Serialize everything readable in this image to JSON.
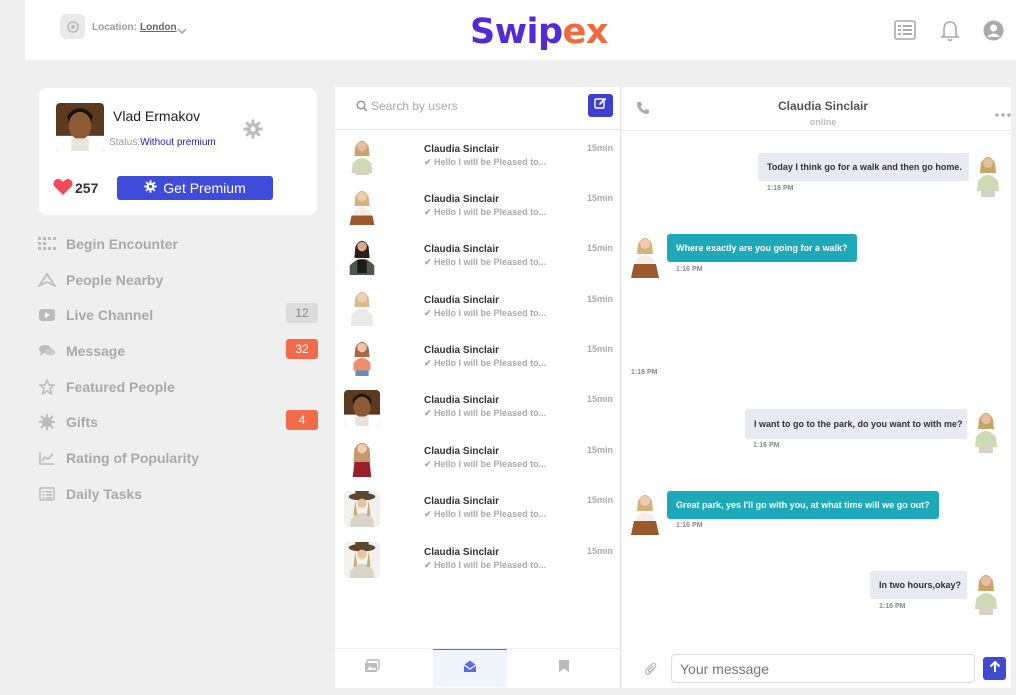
{
  "header": {
    "location_label": "Location:",
    "location_value": "London",
    "logo_part1": "Swip",
    "logo_part2": "ex"
  },
  "profile": {
    "name": "Vlad Ermakov",
    "status_label": "Status:",
    "status_value": "Without premium",
    "likes": "257",
    "premium_button": "Get Premium"
  },
  "nav": {
    "items": [
      {
        "label": "Begin Encounter",
        "icon": "grid-icon",
        "badge": ""
      },
      {
        "label": "People Nearby",
        "icon": "location-arrow-icon",
        "badge": ""
      },
      {
        "label": "Live Channel",
        "icon": "video-icon",
        "badge": "12"
      },
      {
        "label": "Message",
        "icon": "chat-bubbles-icon",
        "badge": "32"
      },
      {
        "label": "Featured People",
        "icon": "star-icon",
        "badge": ""
      },
      {
        "label": "Gifts",
        "icon": "gift-icon",
        "badge": "4"
      },
      {
        "label": "Rating of Popularity",
        "icon": "chart-icon",
        "badge": ""
      },
      {
        "label": "Daily Tasks",
        "icon": "list-icon",
        "badge": ""
      }
    ]
  },
  "search": {
    "placeholder": "Search by users"
  },
  "conversations": [
    {
      "name": "Claudia Sinclair",
      "preview": "Hello I will be Pleased to...",
      "time": "15min"
    },
    {
      "name": "Claudia Sinclair",
      "preview": "Hello I will be Pleased to...",
      "time": "15min"
    },
    {
      "name": "Claudia Sinclair",
      "preview": "Hello I will be Pleased to...",
      "time": "15min"
    },
    {
      "name": "Claudia Sinclair",
      "preview": "Hello I will be Pleased to...",
      "time": "15min"
    },
    {
      "name": "Claudia Sinclair",
      "preview": "Hello I will be Pleased to...",
      "time": "15min"
    },
    {
      "name": "Claudia Sinclair",
      "preview": "Hello I will be Pleased to...",
      "time": "15min"
    },
    {
      "name": "Claudia Sinclair",
      "preview": "Hello I will be Pleased to...",
      "time": "15min"
    },
    {
      "name": "Claudia Sinclair",
      "preview": "Hello I will be Pleased to...",
      "time": "15min"
    },
    {
      "name": "Claudia Sinclair",
      "preview": "Hello I will be Pleased to...",
      "time": "15min"
    }
  ],
  "chat": {
    "contact_name": "Claudia Sinclair",
    "contact_status": "online",
    "messages": [
      {
        "text": "Today I think go for a walk and then go home.",
        "time": "1:16 PM"
      },
      {
        "text": "Where exactly are you going for a walk?",
        "time": "1:16 PM"
      },
      {
        "text": "",
        "time": "1:16 PM"
      },
      {
        "text": "I want to go to the park, do you want to with me?",
        "time": "1:16 PM"
      },
      {
        "text": "Great park, yes I'll go with you, at what time will we go out?",
        "time": "1:16 PM"
      },
      {
        "text": "In two hours,okay?",
        "time": "1:16 PM"
      }
    ],
    "input_placeholder": "Your message"
  },
  "colors": {
    "brand_purple": "#5629d6",
    "brand_orange": "#f06a3a",
    "primary_button": "#3f4bd9",
    "incoming_bubble": "#1da9b8",
    "outgoing_bubble": "#e8e9f2",
    "badge_orange": "#f26b4a"
  }
}
